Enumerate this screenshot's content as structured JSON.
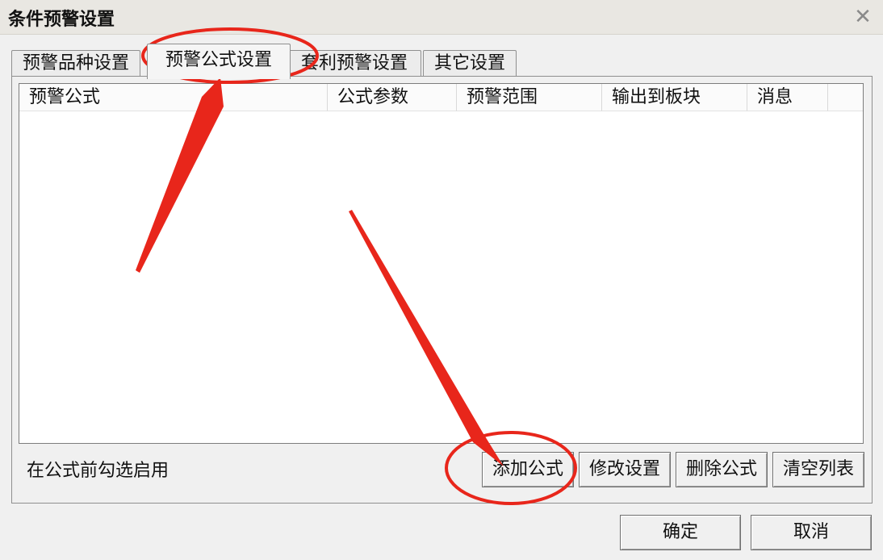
{
  "dialog": {
    "title": "条件预警设置",
    "close_glyph": "✕",
    "tabs": [
      {
        "label": "预警品种设置",
        "active": false
      },
      {
        "label": "预警公式设置",
        "active": true
      },
      {
        "label": "套利预警设置",
        "active": false
      },
      {
        "label": "其它设置",
        "active": false
      }
    ],
    "table": {
      "columns": [
        "预警公式",
        "公式参数",
        "预警范围",
        "输出到板块",
        "消息"
      ],
      "rows": []
    },
    "hint": "在公式前勾选启用",
    "buttons": {
      "add_formula": "添加公式",
      "modify_settings": "修改设置",
      "delete_formula": "删除公式",
      "clear_list": "清空列表",
      "ok": "确定",
      "cancel": "取消"
    }
  },
  "annotation_color": "#e8261b"
}
